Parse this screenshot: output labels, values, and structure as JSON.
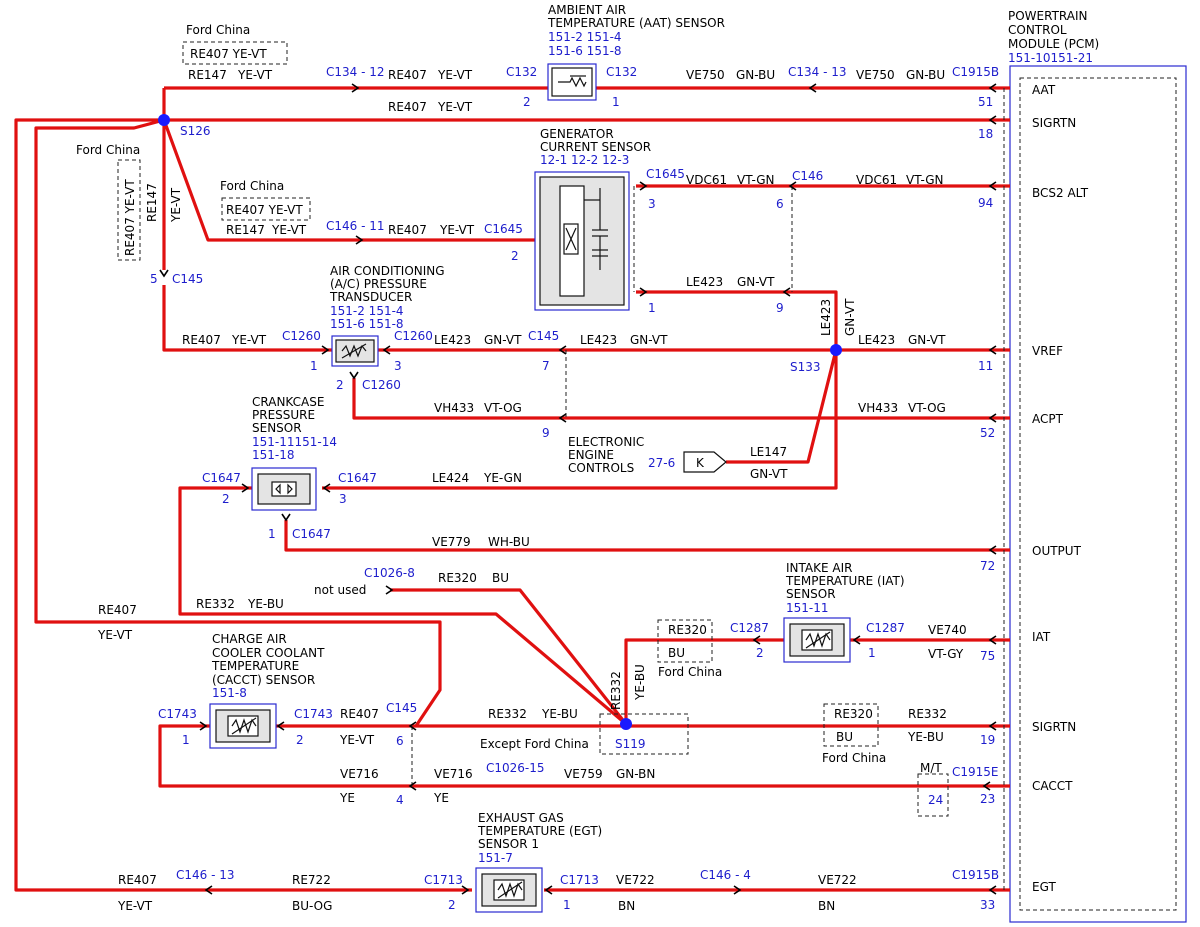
{
  "pcm": {
    "title": [
      "POWERTRAIN",
      "CONTROL",
      "MODULE (PCM)"
    ],
    "refs": "151-10151-21",
    "pins": [
      {
        "label": "AAT",
        "pin": "51",
        "connector": "C1915B"
      },
      {
        "label": "SIGRTN",
        "pin": "18"
      },
      {
        "label": "BCS2 ALT",
        "pin": "94"
      },
      {
        "label": "VREF",
        "pin": "11"
      },
      {
        "label": "ACPT",
        "pin": "52"
      },
      {
        "label": "OUTPUT",
        "pin": "72"
      },
      {
        "label": "IAT",
        "pin": "75"
      },
      {
        "label": "SIGRTN",
        "pin": "19"
      },
      {
        "label": "CACCT",
        "pin": "23",
        "connector": "C1915E"
      },
      {
        "label": "EGT",
        "pin": "33",
        "connector": "C1915B"
      }
    ]
  },
  "components": {
    "aat": {
      "name": [
        "AMBIENT AIR",
        "TEMPERATURE (AAT) SENSOR"
      ],
      "refs": [
        "151-2 151-4",
        "151-6 151-8"
      ],
      "conn_left": "C132",
      "conn_right": "C132",
      "pin_left": "2",
      "pin_right": "1"
    },
    "gen": {
      "name": [
        "GENERATOR",
        "CURRENT SENSOR"
      ],
      "refs": "12-1  12-2  12-3",
      "pin_left": "2",
      "conn_left": "C1645",
      "conn_right_top": "C1645",
      "pin_right_top": "3",
      "pin_right_bottom": "1"
    },
    "ac": {
      "name": [
        "AIR CONDITIONING",
        "(A/C) PRESSURE",
        "TRANSDUCER"
      ],
      "refs": [
        "151-2 151-4",
        "151-6 151-8"
      ],
      "conn_left": "C1260",
      "conn_right": "C1260",
      "conn_bottom": "C1260",
      "pin_left": "1",
      "pin_right": "3",
      "pin_bottom": "2"
    },
    "crank": {
      "name": [
        "CRANKCASE",
        "PRESSURE",
        "SENSOR"
      ],
      "refs": [
        "151-11151-14",
        "151-18"
      ],
      "conn_left": "C1647",
      "conn_right": "C1647",
      "conn_bottom": "C1647",
      "pin_left": "2",
      "pin_right": "3",
      "pin_bottom": "1"
    },
    "iat": {
      "name": [
        "INTAKE AIR",
        "TEMPERATURE (IAT)",
        "SENSOR"
      ],
      "refs": "151-11",
      "conn_left": "C1287",
      "conn_right": "C1287",
      "pin_left": "2",
      "pin_right": "1"
    },
    "cacct": {
      "name": [
        "CHARGE AIR",
        "COOLER COOLANT",
        "TEMPERATURE",
        "(CACCT) SENSOR"
      ],
      "refs": "151-8",
      "conn_left": "C1743",
      "conn_right": "C1743",
      "pin_left": "1",
      "pin_right": "2"
    },
    "egt": {
      "name": [
        "EXHAUST GAS",
        "TEMPERATURE (EGT)",
        "SENSOR 1"
      ],
      "refs": "151-7",
      "conn_left": "C1713",
      "conn_right": "C1713",
      "pin_left": "2",
      "pin_right": "1"
    },
    "eec": {
      "name": [
        "ELECTRONIC",
        "ENGINE",
        "CONTROLS"
      ],
      "ref": "27-6",
      "symbol": "K"
    }
  },
  "splices": {
    "s126": "S126",
    "s133": "S133",
    "s119": "S119"
  },
  "connectors": {
    "c134_12": "C134 - 12",
    "c134_13": "C134 - 13",
    "c146_11": "C146 - 11",
    "c146": "C146",
    "c146_pin": "6",
    "c146_pin2": "9",
    "c145": "C145",
    "c145_pin": "5",
    "c145_mid": "C145",
    "c145_mid_pin1": "7",
    "c145_mid_pin2": "9",
    "c1026_8": "C1026-8",
    "c1287": "C1287",
    "c145_low": "C145",
    "c145_low_pin1": "6",
    "c145_low_pin2": "4",
    "c1026_15": "C1026-15",
    "c146_13": "C146 - 13",
    "c146_4": "C146 - 4"
  },
  "wires": {
    "re407": "RE407",
    "re147": "RE147",
    "ye_vt": "YE-VT",
    "ve750": "VE750",
    "gn_bu": "GN-BU",
    "vdc61": "VDC61",
    "vt_gn": "VT-GN",
    "le423": "LE423",
    "gn_vt": "GN-VT",
    "vh433": "VH433",
    "vt_og": "VT-OG",
    "le147": "LE147",
    "le424": "LE424",
    "ye_gn": "YE-GN",
    "ve779": "VE779",
    "wh_bu": "WH-BU",
    "re320": "RE320",
    "bu": "BU",
    "re332": "RE332",
    "ye_bu": "YE-BU",
    "ve740": "VE740",
    "vt_gy": "VT-GY",
    "ve716": "VE716",
    "ye": "YE",
    "ve759": "VE759",
    "gn_bn": "GN-BN",
    "re722": "RE722",
    "bu_og": "BU-OG",
    "ve722": "VE722",
    "bn": "BN"
  },
  "notes": {
    "ford_china": "Ford China",
    "re407_yevt": "RE407  YE-VT",
    "re320": "RE320",
    "bu": "BU",
    "except_ford_china": "Except Ford China",
    "not_used": "not used",
    "mt": "M/T",
    "mt_pin": "24"
  },
  "colors": {
    "wire": "#e01010",
    "ref": "#1d1dcc",
    "component_border": "#2a2ad0",
    "node": "#1a1aff"
  }
}
